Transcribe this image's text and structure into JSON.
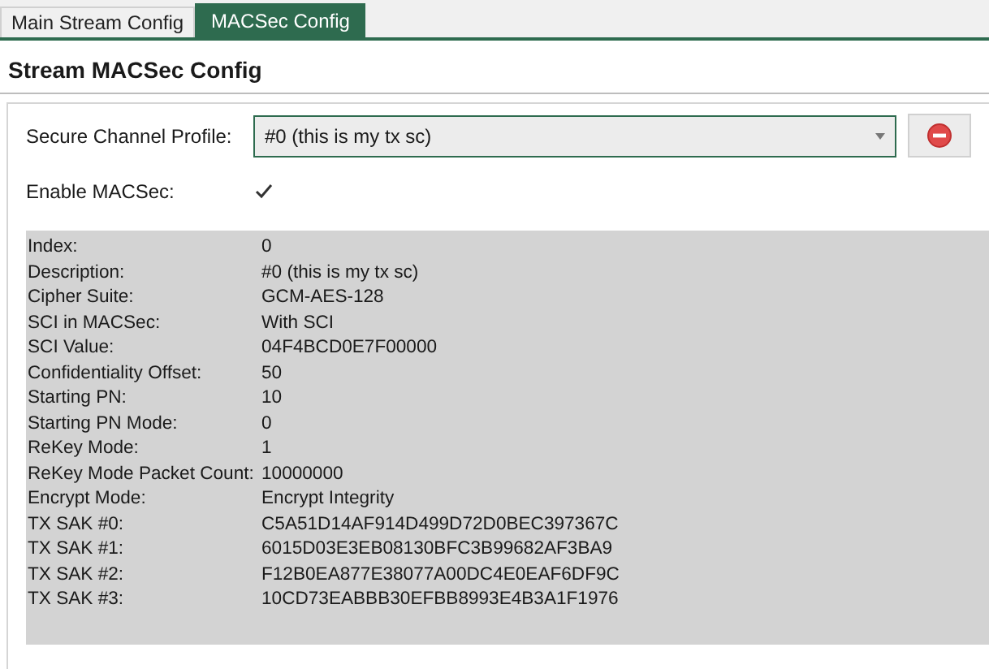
{
  "tabs": [
    {
      "label": "Main Stream Config",
      "selected": false
    },
    {
      "label": "MACSec Config",
      "selected": true
    }
  ],
  "section_title": "Stream MACSec Config",
  "profile": {
    "label": "Secure Channel Profile:",
    "value": "#0 (this is my tx sc)"
  },
  "enable_macsec": {
    "label": "Enable MACSec:",
    "checked": true
  },
  "details": [
    {
      "label": "Index:",
      "value": "0"
    },
    {
      "label": "Description:",
      "value": "#0 (this is my tx sc)"
    },
    {
      "label": "Cipher Suite:",
      "value": "GCM-AES-128"
    },
    {
      "label": "SCI in MACSec:",
      "value": "With SCI"
    },
    {
      "label": "SCI Value:",
      "value": "04F4BCD0E7F00000"
    },
    {
      "label": "Confidentiality Offset:",
      "value": "50"
    },
    {
      "label": "Starting PN:",
      "value": "10"
    },
    {
      "label": "Starting PN Mode:",
      "value": "0"
    },
    {
      "label": "ReKey Mode:",
      "value": "1"
    },
    {
      "label": "ReKey Mode Packet Count:",
      "value": "10000000"
    },
    {
      "label": "Encrypt Mode:",
      "value": "Encrypt Integrity"
    },
    {
      "label": "TX SAK #0:",
      "value": "C5A51D14AF914D499D72D0BEC397367C"
    },
    {
      "label": "TX SAK #1:",
      "value": "6015D03E3EB08130BFC3B99682AF3BA9"
    },
    {
      "label": "TX SAK #2:",
      "value": "F12B0EA877E38077A00DC4E0EAF6DF9C"
    },
    {
      "label": "TX SAK #3:",
      "value": "10CD73EABBB30EFBB8993E4B3A1F1976"
    }
  ]
}
